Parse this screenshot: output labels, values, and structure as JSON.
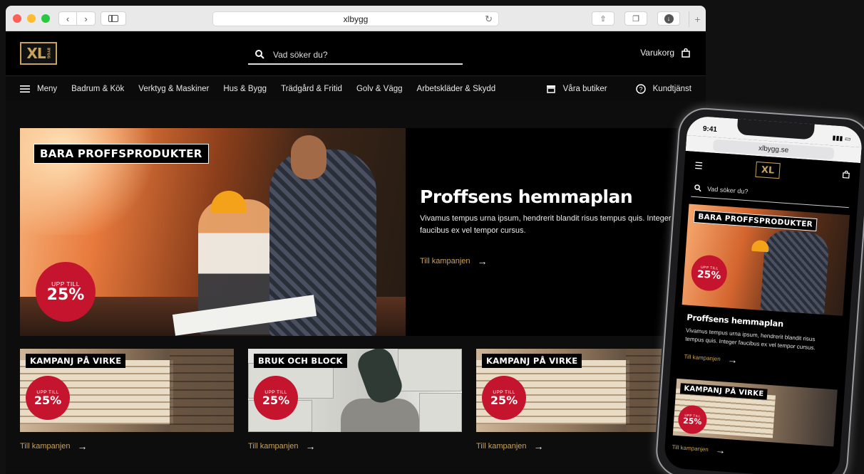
{
  "browser": {
    "url": "xlbygg",
    "new_tab": "+"
  },
  "header": {
    "logo": "XL",
    "logo_sub": "BYGG",
    "search_placeholder": "Vad söker du?",
    "cart_label": "Varukorg"
  },
  "nav": {
    "menu_label": "Meny",
    "items": [
      "Badrum & Kök",
      "Verktyg & Maskiner",
      "Hus & Bygg",
      "Trädgård & Fritid",
      "Golv & Vägg",
      "Arbetskläder & Skydd"
    ],
    "stores_label": "Våra butiker",
    "service_label": "Kundtjänst"
  },
  "hero": {
    "tag": "BARA PROFFSPRODUKTER",
    "badge_top": "UPP TILL",
    "badge_value": "25%",
    "title": "Proffsens hemmaplan",
    "body": "Vivamus tempus urna ipsum, hendrerit blandit risus tempus quis. Integer faucibus ex vel tempor cursus.",
    "cta": "Till kampanjen"
  },
  "cards": [
    {
      "tag": "KAMPANJ PÅ VIRKE",
      "badge_top": "UPP TILL",
      "badge_value": "25%",
      "cta": "Till kampanjen"
    },
    {
      "tag": "BRUK OCH BLOCK",
      "badge_top": "UPP TILL",
      "badge_value": "25%",
      "cta": "Till kampanjen"
    },
    {
      "tag": "KAMPANJ PÅ VIRKE",
      "badge_top": "UPP TILL",
      "badge_value": "25%",
      "cta": "Till kampanjen"
    }
  ],
  "phone": {
    "time": "9:41",
    "url": "xlbygg.se",
    "logo": "XL",
    "search_placeholder": "Vad söker du?",
    "hero_tag": "BARA PROFFSPRODUKTER",
    "hero_badge_top": "UPP TILL",
    "hero_badge_value": "25%",
    "hero_title": "Proffsens hemmaplan",
    "hero_body": "Vivamus tempus urna ipsum, hendrerit blandit risus tempus quis. Integer faucibus ex vel tempor cursus.",
    "hero_cta": "Till kampanjen",
    "card_tag": "KAMPANJ PÅ VIRKE",
    "card_badge_top": "UPP TILL",
    "card_badge_value": "25%",
    "card_cta": "Till kampanjen"
  },
  "colors": {
    "accent_gold": "#c8a35a",
    "badge_red": "#c5152e",
    "background": "#0b0b0b"
  },
  "icons": [
    "back-icon",
    "forward-icon",
    "sidebar-icon",
    "reload-icon",
    "share-icon",
    "tabs-icon",
    "download-icon",
    "search-icon",
    "bag-icon",
    "hamburger-icon",
    "store-icon",
    "help-icon",
    "arrow-right-icon"
  ]
}
